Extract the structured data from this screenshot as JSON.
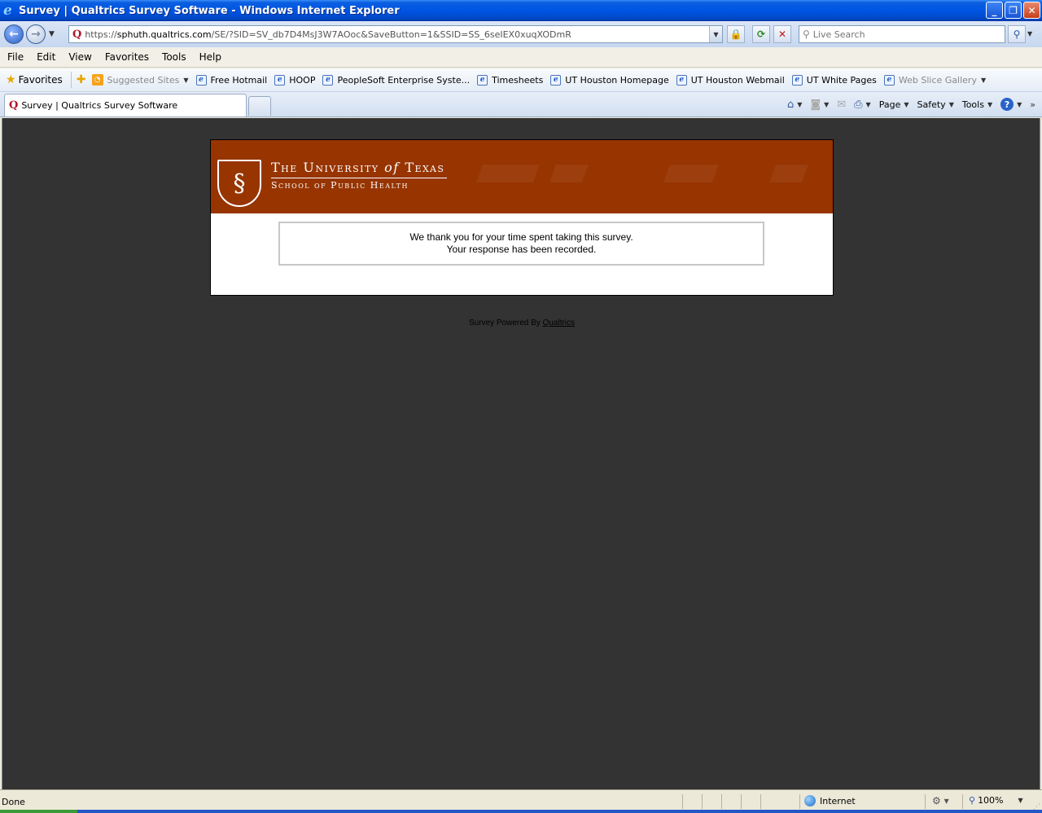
{
  "window": {
    "title": "Survey | Qualtrics Survey Software - Windows Internet Explorer",
    "app_icon": "ie-icon"
  },
  "address_bar": {
    "url_prefix": "https://",
    "url_host": "sphuth.qualtrics.com",
    "url_rest": "/SE/?SID=SV_db7D4MsJ3W7AOoc&SaveButton=1&SSID=SS_6seIEX0xuqXODmR"
  },
  "search": {
    "placeholder": "Live Search"
  },
  "menu": [
    "File",
    "Edit",
    "View",
    "Favorites",
    "Tools",
    "Help"
  ],
  "favorites_bar": {
    "label": "Favorites",
    "links": [
      {
        "label": "Suggested Sites",
        "icon": "rss-icon",
        "dropdown": true,
        "muted": true
      },
      {
        "label": "Free Hotmail",
        "icon": "ie-page-icon"
      },
      {
        "label": "HOOP",
        "icon": "ie-page-icon"
      },
      {
        "label": "PeopleSoft Enterprise Syste...",
        "icon": "ie-page-icon"
      },
      {
        "label": "Timesheets",
        "icon": "ie-page-icon"
      },
      {
        "label": "UT Houston Homepage",
        "icon": "ie-page-icon"
      },
      {
        "label": "UT Houston Webmail",
        "icon": "ie-page-icon"
      },
      {
        "label": "UT White Pages",
        "icon": "ie-page-icon"
      },
      {
        "label": "Web Slice Gallery",
        "icon": "ie-page-icon",
        "dropdown": true,
        "muted": true
      }
    ]
  },
  "tabs": {
    "active_label": "Survey | Qualtrics Survey Software"
  },
  "command_bar": {
    "page": "Page",
    "safety": "Safety",
    "tools": "Tools"
  },
  "page": {
    "background": "#333333",
    "banner_color": "#973400",
    "banner": {
      "line1_the": "The University",
      "line1_of": "of",
      "line1_texas": "Texas",
      "line2": "School of Public Health"
    },
    "message_line1": "We thank you for your time spent taking this survey.",
    "message_line2": "Your response has been recorded.",
    "powered_text": "Survey Powered By",
    "powered_link": "Qualtrics"
  },
  "status_bar": {
    "status": "Done",
    "zone": "Internet",
    "zoom": "100%"
  }
}
